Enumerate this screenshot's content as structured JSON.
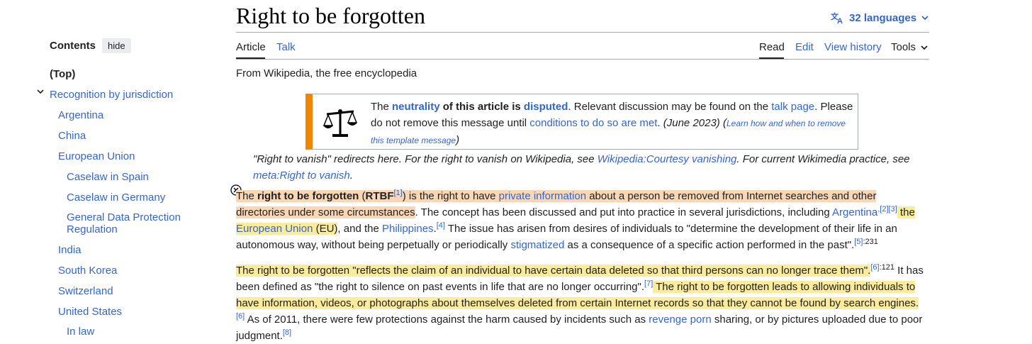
{
  "toc": {
    "heading": "Contents",
    "hide_label": "hide",
    "items": [
      {
        "label": "(Top)"
      },
      {
        "label": "Recognition by jurisdiction"
      },
      {
        "label": "Argentina"
      },
      {
        "label": "China"
      },
      {
        "label": "European Union"
      },
      {
        "label": "Caselaw in Spain"
      },
      {
        "label": "Caselaw in Germany"
      },
      {
        "label": "General Data Protection Regulation"
      },
      {
        "label": "India"
      },
      {
        "label": "South Korea"
      },
      {
        "label": "Switzerland"
      },
      {
        "label": "United States"
      },
      {
        "label": "In law"
      }
    ]
  },
  "article": {
    "title": "Right to be forgotten",
    "languages": "32 languages",
    "tabs": {
      "article": "Article",
      "talk": "Talk",
      "read": "Read",
      "edit": "Edit",
      "history": "View history",
      "tools": "Tools"
    },
    "tagline": "From Wikipedia, the free encyclopedia"
  },
  "ambox": {
    "t1": "The ",
    "l_neutrality": "neutrality",
    "t2": " of this article is ",
    "l_disputed": "disputed",
    "t3": ". Relevant discussion may be found on the ",
    "l_talk": "talk page",
    "t4": ". Please do not remove this message until ",
    "l_conditions": "conditions to do so are met",
    "t5": ". ",
    "date": "(June 2023)",
    "t6": " (",
    "l_learn": "Learn how and when to remove this template message",
    "t7": ")"
  },
  "hatnote": {
    "t1": "\"Right to vanish\" redirects here. For the right to vanish on Wikipedia, see ",
    "l1": "Wikipedia:Courtesy vanishing",
    "t2": ". For current Wikimedia practice, see ",
    "l2": "meta:Right to vanish",
    "t3": "."
  },
  "p1": {
    "a": "The ",
    "b": "right to be forgotten",
    "c": " (",
    "d": "RTBF",
    "s1": "[1]",
    "e": ") is the right to have ",
    "l_private": "private information",
    "f": " about a person be removed from Internet searches and other directories under some circumstances",
    "g": ". The concept has been discussed and put into practice in several jurisdictions, including ",
    "l_arg": "Argentina",
    "s2": ",[2]",
    "s3": "[3]",
    "h": " the ",
    "l_eu": "European Union",
    "i": " (EU)",
    "j": ", and the ",
    "l_ph": "Philippines",
    "s4": "[4]",
    "k": " The issue has arisen from desires of individuals to \"determine the development of their life in an autonomous way, without being perpetually or periodically ",
    "l_stig": "stigmatized",
    "m": " as a consequence of a specific action performed in the past\".",
    "s5": "[5]",
    "s5b": ":231"
  },
  "p2": {
    "a": "The right to be forgotten \"reflects the claim of an individual to have certain data deleted so that third persons can no longer trace them\".",
    "s6": "[6]",
    "s6b": ":121",
    "b": " It has been defined as \"the right to silence on past events in life that are no longer occurring\".",
    "s7": "[7]",
    "c": " The right to be forgotten leads to allowing individuals to have information, videos, or photographs about themselves deleted from certain Internet records so that they cannot be found by search engines.",
    "s6c": "[6]",
    "d": " As of 2011, there were few protections against the harm caused by incidents such as ",
    "l_rp": "revenge porn",
    "e": " sharing, or by pictures uploaded due to poor judgment.",
    "s8": "[8]"
  }
}
